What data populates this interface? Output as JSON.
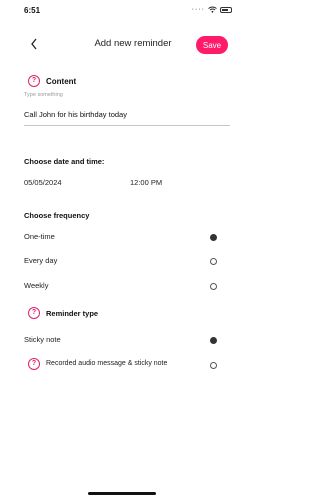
{
  "status_bar": {
    "time": "6:51",
    "signal_icon": "dots-icon",
    "wifi_icon": "wifi-icon",
    "battery_icon": "battery-icon"
  },
  "header": {
    "back_icon": "chevron-left-icon",
    "title": "Add new reminder",
    "save_label": "Save"
  },
  "content": {
    "title": "Content",
    "placeholder": "Type something",
    "value": "Call John for his birthday today"
  },
  "date_time": {
    "title": "Choose date and time:",
    "date": "05/05/2024",
    "time": "12:00 PM"
  },
  "frequency": {
    "title": "Choose frequency",
    "options": [
      {
        "label": "One-time",
        "selected": true
      },
      {
        "label": "Every day",
        "selected": false
      },
      {
        "label": "Weekly",
        "selected": false
      }
    ]
  },
  "reminder_type": {
    "title": "Reminder type",
    "options": [
      {
        "label": "Sticky note",
        "selected": true
      },
      {
        "label": "Recorded audio message & sticky note",
        "selected": false
      }
    ]
  },
  "colors": {
    "accent": "#ff1a6a",
    "help_icon": "#e0206a"
  }
}
